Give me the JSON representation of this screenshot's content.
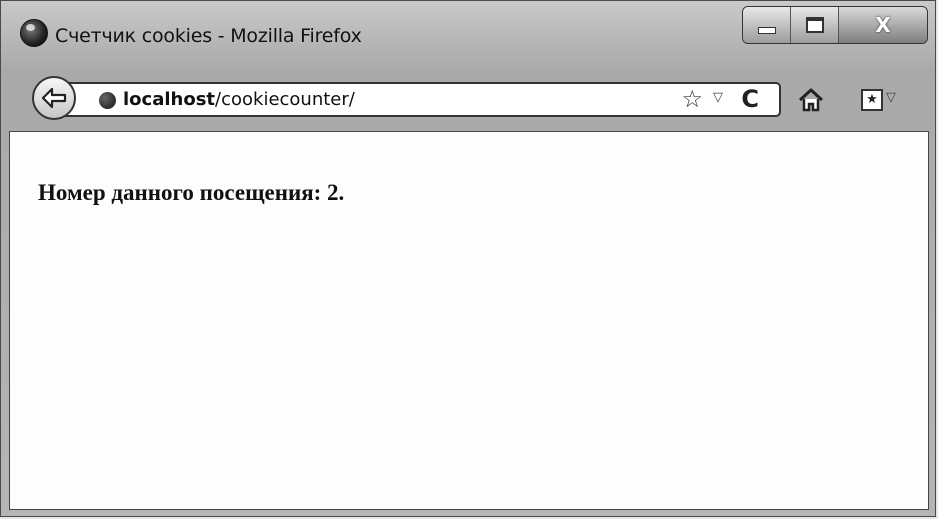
{
  "window": {
    "title": "Счетчик cookies - Mozilla Firefox",
    "icons": {
      "app": "firefox-icon",
      "minimize": "minimize-icon",
      "maximize": "maximize-icon",
      "close": "close-icon"
    },
    "close_label": "X"
  },
  "navbar": {
    "back_icon": "back-arrow-icon",
    "site_icon": "globe-icon",
    "url_host": "localhost",
    "url_path": "/cookiecounter/",
    "star_glyph": "☆",
    "dropdown_glyph": "▽",
    "reload_glyph": "C",
    "home_icon": "home-icon",
    "bookmarks_glyph": "★",
    "bookmarks_dropdown_glyph": "▽"
  },
  "page": {
    "visit_text": "Номер данного посещения: 2."
  }
}
